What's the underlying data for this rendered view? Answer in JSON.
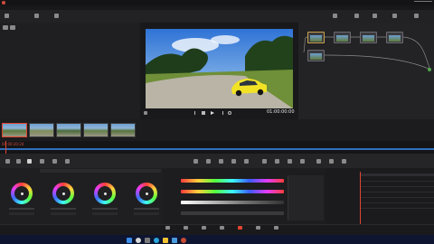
{
  "window": {
    "title": ""
  },
  "menu": {
    "items": [
      "",
      "",
      "",
      "",
      "",
      "",
      "",
      "",
      "",
      "",
      "",
      "",
      ""
    ]
  },
  "toolbar": {
    "center_title": "",
    "center_subtitle": "",
    "left_labels": [
      "",
      "",
      ""
    ],
    "right_labels": [
      "",
      "",
      "",
      ""
    ]
  },
  "viewer": {
    "header_label": "",
    "header_timecode": "",
    "timecode": "01:00:00:00",
    "zoom_label": "",
    "placeholder_text": "",
    "image_icon": "photo-car-icon"
  },
  "clips": {
    "items": [
      {
        "label": "",
        "color": "#5d7a3e"
      },
      {
        "label": "",
        "color": "#7e8d5a"
      },
      {
        "label": "",
        "color": "#4a6b3a"
      },
      {
        "label": "",
        "color": "#65804a"
      },
      {
        "label": "",
        "color": "#56733c"
      }
    ],
    "timecode": "00:00:20:24",
    "clip_numbers": [
      "",
      "",
      ""
    ]
  },
  "primaries": {
    "title": "",
    "wheels": [
      {
        "label": ""
      },
      {
        "label": ""
      },
      {
        "label": ""
      },
      {
        "label": ""
      }
    ],
    "values": [
      "",
      "",
      "",
      "",
      "",
      "",
      "",
      "",
      "",
      "",
      ""
    ]
  },
  "curves": {
    "title": "",
    "hue_label": "",
    "sat_label": "",
    "lum_label": "",
    "values": [
      "",
      "",
      "",
      ""
    ]
  },
  "keyframes": {
    "title": "",
    "rows": [
      "",
      "",
      "",
      "",
      "",
      ""
    ]
  },
  "bottom_tabs": {
    "items": [
      "",
      "",
      "",
      "",
      "",
      "",
      ""
    ]
  },
  "taskbar": {
    "app_label": "",
    "time": "",
    "date": ""
  },
  "colors": {
    "accent": "#e0452f",
    "playhead": "#e0452f",
    "timeline_line": "#2f6fbf",
    "sat_bar_start": "#ff3b3b"
  }
}
